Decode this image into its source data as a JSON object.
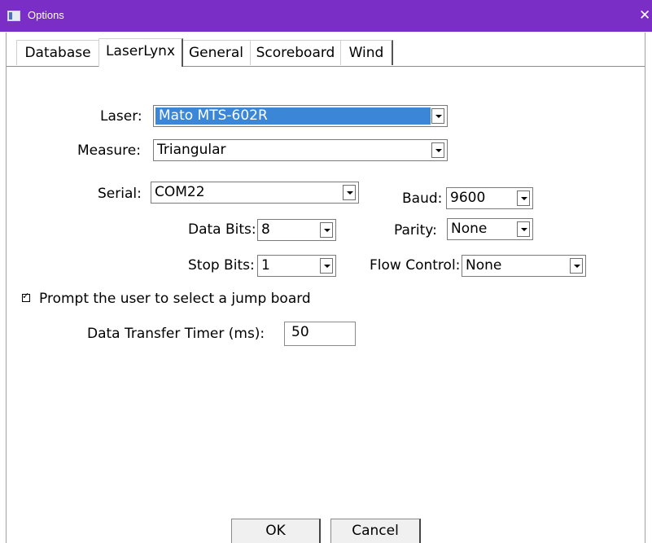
{
  "window": {
    "title": "Options",
    "close_glyph": "✕"
  },
  "tabs": [
    {
      "label": "Database"
    },
    {
      "label": "LaserLynx",
      "active": true
    },
    {
      "label": "General"
    },
    {
      "label": "Scoreboard"
    },
    {
      "label": "Wind"
    }
  ],
  "form": {
    "laser": {
      "label": "Laser:",
      "value": "Mato MTS-602R"
    },
    "measure": {
      "label": "Measure:",
      "value": "Triangular"
    },
    "serial": {
      "label": "Serial:",
      "value": "COM22"
    },
    "baud": {
      "label": "Baud:",
      "value": "9600"
    },
    "data_bits": {
      "label": "Data Bits:",
      "value": "8"
    },
    "parity": {
      "label": "Parity:",
      "value": "None"
    },
    "stop_bits": {
      "label": "Stop Bits:",
      "value": "1"
    },
    "flow_control": {
      "label": "Flow Control:",
      "value": "None"
    },
    "prompt_jump_board": {
      "label": "Prompt the user to select a jump board",
      "checked": true,
      "mark": "✓"
    },
    "data_transfer_timer": {
      "label": "Data Transfer Timer (ms):",
      "value": "50"
    }
  },
  "buttons": {
    "ok": "OK",
    "cancel": "Cancel"
  },
  "colors": {
    "titlebar": "#7a2ec6",
    "selection": "#3b86d6"
  }
}
